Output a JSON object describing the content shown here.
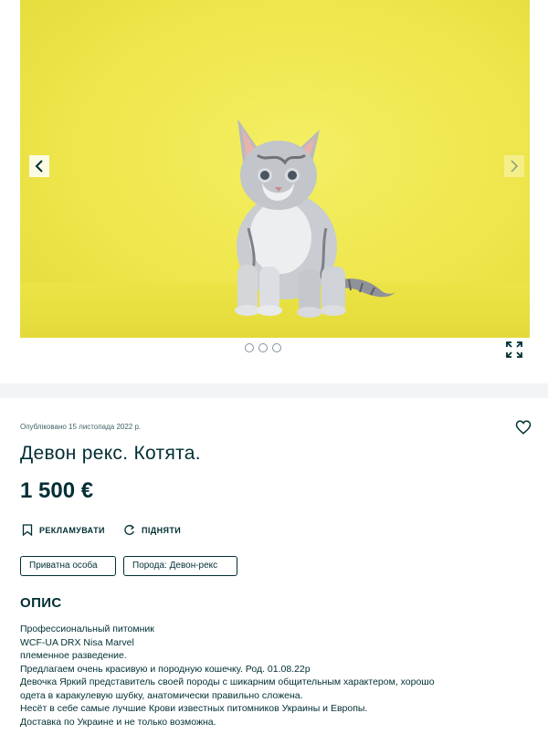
{
  "gallery": {
    "photo_alt": "",
    "prev_icon": "chevron-left-icon",
    "next_icon": "chevron-right-icon",
    "dots_count": 3,
    "fullscreen_icon": "expand-icon",
    "photo_background": "#eee64b"
  },
  "listing": {
    "published": "Опубліковано 15 листопада 2022 р.",
    "favorite_icon": "heart-icon",
    "title": "Девон рекс. Котята.",
    "price": "1 500 €",
    "actions": {
      "promote_label": "РЕКЛАМУВАТИ",
      "raise_label": "ПІДНЯТИ"
    },
    "tags": [
      "Приватна особа",
      "Порода: Девон-рекс"
    ],
    "description_heading": "ОПИС",
    "description_lines": [
      "Профессиональный питомник",
      "WCF-UA DRX Nisa Marvel",
      "племенное разведение.",
      "Предлагаем очень красивую и породную кошечку. Род. 01.08.22р",
      "Девочка Яркий представитель своей породы с шикарним общительным характером, хорошо",
      "одета в каракулевую шубку, анатомически правильно сложена.",
      "Несёт в себе самые лучшие Крови известных питомников Украины и Европы.",
      "Доставка по Украине и не только возможна."
    ]
  },
  "colors": {
    "text": "#002f34",
    "card_bg": "#ffffff",
    "page_bg": "#f2f4f5"
  }
}
